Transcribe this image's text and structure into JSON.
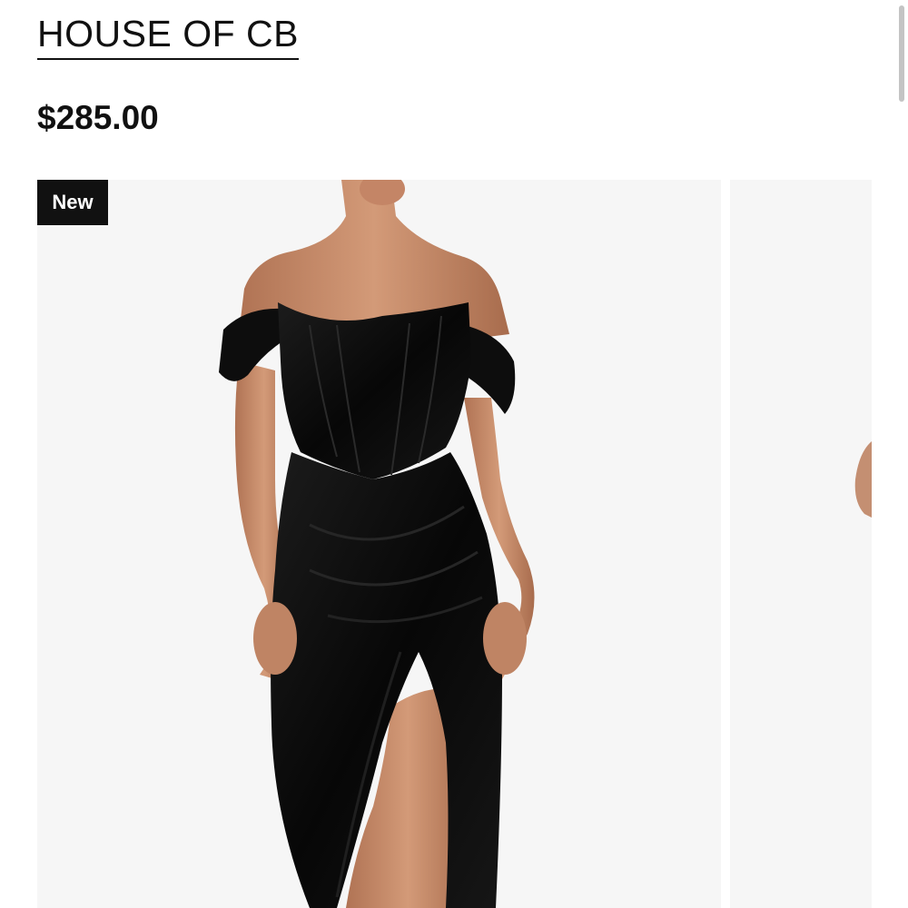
{
  "product": {
    "brand": "HOUSE OF CB",
    "price": "$285.00"
  },
  "gallery": {
    "badge": "New",
    "main_image_alt": "Black off-shoulder corset draped satin midi dress",
    "next_image_alt": "Next product image"
  },
  "colors": {
    "text": "#111111",
    "badge_bg": "#111111",
    "badge_text": "#ffffff",
    "image_bg": "#f6f6f6",
    "dress": "#0b0b0b",
    "skin": "#c98e6e"
  }
}
